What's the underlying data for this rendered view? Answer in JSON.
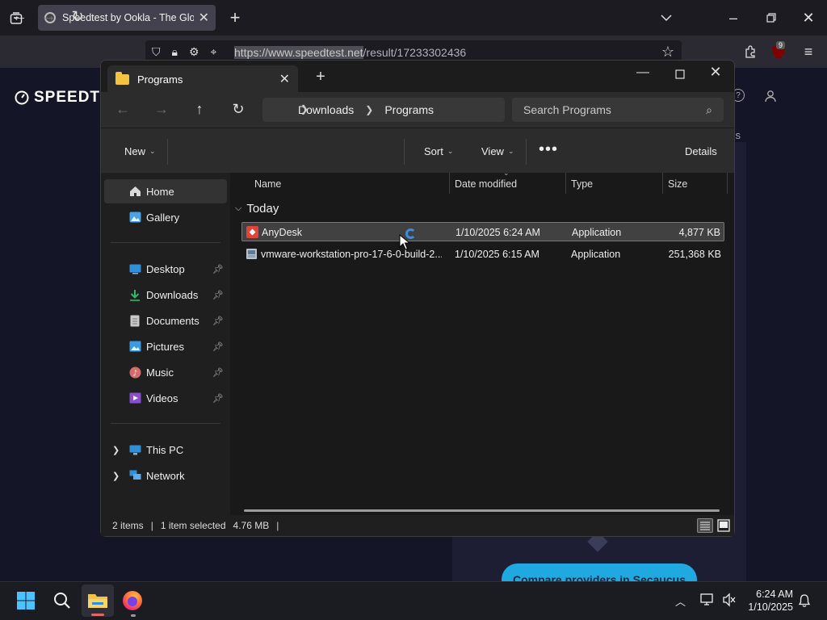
{
  "browser": {
    "tab_title": "Speedtest by Ookla - The Global Broadband Speed Test",
    "url_host": "https://www.speedtest.net",
    "url_path": "/result/17233302436",
    "extension_badge": "9"
  },
  "site": {
    "logo_text": "SPEEDTEST",
    "card_text_fragment": "ss",
    "compare_button": "Compare providers in Secaucus"
  },
  "explorer": {
    "tab_title": "Programs",
    "breadcrumb": [
      "Downloads",
      "Programs"
    ],
    "search_placeholder": "Search Programs",
    "commands": {
      "new": "New",
      "sort": "Sort",
      "view": "View",
      "details": "Details"
    },
    "nav": {
      "home": "Home",
      "gallery": "Gallery",
      "desktop": "Desktop",
      "downloads": "Downloads",
      "documents": "Documents",
      "pictures": "Pictures",
      "music": "Music",
      "videos": "Videos",
      "this_pc": "This PC",
      "network": "Network"
    },
    "columns": {
      "name": "Name",
      "date": "Date modified",
      "type": "Type",
      "size": "Size"
    },
    "group_label": "Today",
    "files": [
      {
        "name": "AnyDesk",
        "date": "1/10/2025 6:24 AM",
        "type": "Application",
        "size": "4,877 KB"
      },
      {
        "name": "vmware-workstation-pro-17-6-0-build-2...",
        "date": "1/10/2025 6:15 AM",
        "type": "Application",
        "size": "251,368 KB"
      }
    ],
    "status": {
      "items": "2 items",
      "selected": "1 item selected",
      "size": "4.76 MB"
    }
  },
  "taskbar": {
    "time": "6:24 AM",
    "date": "1/10/2025"
  },
  "colors": {
    "accent_blue": "#3b8be0",
    "folder_yellow": "#f3c342",
    "compare_button": "#1fa9e0",
    "anydesk_red": "#e0433a"
  }
}
